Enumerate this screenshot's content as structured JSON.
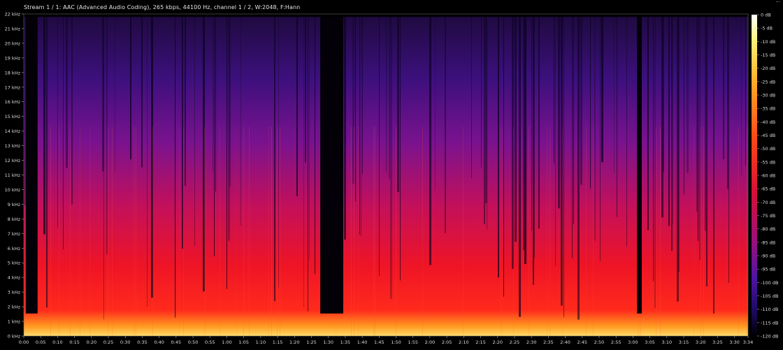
{
  "header": {
    "title": "Stream 1 / 1: AAC (Advanced Audio Coding), 265 kbps, 44100 Hz, channel 1 / 2, W:2048, F:Hann",
    "corner_text": "..."
  },
  "chart_data": {
    "type": "heatmap",
    "title": "Stream 1 / 1: AAC (Advanced Audio Coding), 265 kbps, 44100 Hz, channel 1 / 2, W:2048, F:Hann",
    "x_ticks": [
      "0:00",
      "0:05",
      "0:10",
      "0:15",
      "0:20",
      "0:25",
      "0:30",
      "0:35",
      "0:40",
      "0:45",
      "0:50",
      "0:55",
      "1:00",
      "1:05",
      "1:10",
      "1:15",
      "1:20",
      "1:25",
      "1:30",
      "1:35",
      "1:40",
      "1:45",
      "1:50",
      "1:55",
      "2:00",
      "2:05",
      "2:10",
      "2:15",
      "2:20",
      "2:25",
      "2:30",
      "2:35",
      "2:40",
      "2:45",
      "2:50",
      "2:55",
      "3:00",
      "3:05",
      "3:10",
      "3:15",
      "3:20",
      "3:25",
      "3:30",
      "3:34"
    ],
    "x_tick_seconds": [
      0,
      5,
      10,
      15,
      20,
      25,
      30,
      35,
      40,
      45,
      50,
      55,
      60,
      65,
      70,
      75,
      80,
      85,
      90,
      95,
      100,
      105,
      110,
      115,
      120,
      125,
      130,
      135,
      140,
      145,
      150,
      155,
      160,
      165,
      170,
      175,
      180,
      185,
      190,
      195,
      200,
      205,
      210,
      214
    ],
    "xlim_seconds": [
      0,
      214
    ],
    "y_ticks": [
      "0 kHz",
      "1 kHz",
      "2 kHz",
      "3 kHz",
      "4 kHz",
      "5 kHz",
      "6 kHz",
      "7 kHz",
      "8 kHz",
      "9 kHz",
      "10 kHz",
      "11 kHz",
      "12 kHz",
      "13 kHz",
      "14 kHz",
      "15 kHz",
      "16 kHz",
      "17 kHz",
      "18 kHz",
      "19 kHz",
      "20 kHz",
      "21 kHz",
      "22 kHz"
    ],
    "ylim_khz": [
      0,
      22
    ],
    "colorbar_ticks": [
      "0 dB",
      "-5 dB",
      "-10 dB",
      "-15 dB",
      "-20 dB",
      "-25 dB",
      "-30 dB",
      "-35 dB",
      "-40 dB",
      "-45 dB",
      "-50 dB",
      "-55 dB",
      "-60 dB",
      "-65 dB",
      "-70 dB",
      "-75 dB",
      "-80 dB",
      "-85 dB",
      "-90 dB",
      "-95 dB",
      "-100 dB",
      "-105 dB",
      "-110 dB",
      "-115 dB",
      "-120 dB"
    ],
    "colorbar_range_db": [
      0,
      -120
    ],
    "silent_segments_seconds": [
      [
        0.6,
        4.1
      ],
      [
        87.6,
        94.4
      ],
      [
        181.2,
        182.6
      ]
    ],
    "content_cutoff_khz": 21.8
  }
}
